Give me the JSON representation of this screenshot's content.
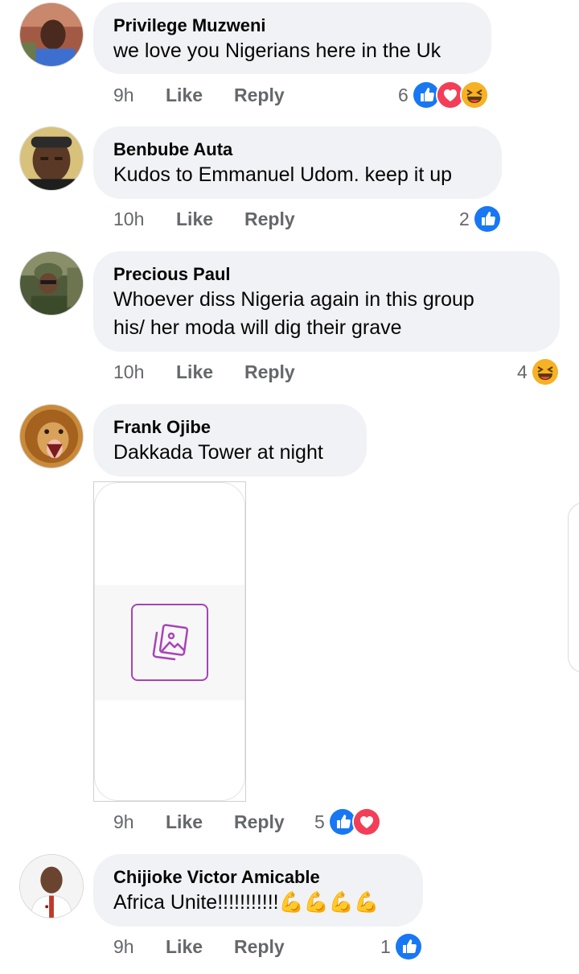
{
  "colors": {
    "like_blue": "#1877f2",
    "love_red": "#f33e58",
    "haha_yellow": "#f7b125",
    "bubble_bg": "#f0f2f5",
    "meta_gray": "#65676b"
  },
  "comments": [
    {
      "author": "Privilege Muzweni",
      "lines": [
        "we love you Nigerians here in the Uk"
      ],
      "time": "9h",
      "like": "Like",
      "reply": "Reply",
      "reaction_count": "6",
      "reactions": [
        "like-icon",
        "love-icon",
        "haha-icon"
      ]
    },
    {
      "author": "Benbube Auta",
      "lines": [
        "Kudos to Emmanuel Udom. keep it up"
      ],
      "time": "10h",
      "like": "Like",
      "reply": "Reply",
      "reaction_count": "2",
      "reactions": [
        "like-icon"
      ]
    },
    {
      "author": "Precious Paul",
      "lines": [
        "Whoever diss Nigeria again in this group",
        "his/ her moda will dig their grave"
      ],
      "time": "10h",
      "like": "Like",
      "reply": "Reply",
      "reaction_count": "4",
      "reactions": [
        "haha-icon"
      ]
    },
    {
      "author": "Frank Ojibe",
      "lines": [
        "Dakkada Tower at night"
      ],
      "attachment": "photo-placeholder-icon",
      "time": "9h",
      "like": "Like",
      "reply": "Reply",
      "reaction_count": "5",
      "reactions": [
        "like-icon",
        "love-icon"
      ]
    },
    {
      "author": "Chijioke Victor Amicable",
      "lines": [
        "Africa Unite!!!!!!!!!!!💪💪💪💪"
      ],
      "time": "9h",
      "like": "Like",
      "reply": "Reply",
      "reaction_count": "1",
      "reactions": [
        "like-icon"
      ]
    }
  ]
}
